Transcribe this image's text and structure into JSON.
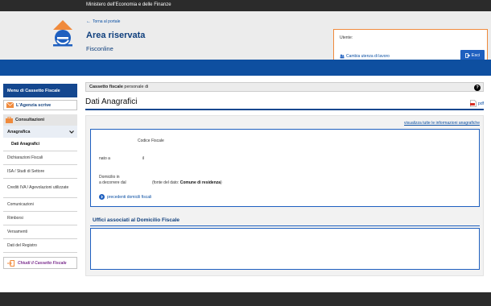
{
  "topbar": {
    "ministry": "Ministero dell'Economia e delle Finanze"
  },
  "header": {
    "back_link": "Torna al portale",
    "title": "Area riservata",
    "subtitle": "Fisconline"
  },
  "user": {
    "label": "Utente:",
    "change_link": "Cambia utenza di lavoro",
    "exit_label": "Esci"
  },
  "sidebar": {
    "menu_title": "Menu di Cassetto Fiscale",
    "agency": "L'Agenzia scrive",
    "consult": "Consultazioni",
    "anagrafica": "Anagrafica",
    "items": [
      "Dati Anagrafici",
      "Dichiarazioni Fiscali",
      "ISA / Studi di Settore",
      "Crediti IVA / Agevolazioni utilizzate",
      "Comunicazioni",
      "Rimborsi",
      "Versamenti",
      "Dati del Registro"
    ],
    "close": "Chiudi il Cassetto Fiscale"
  },
  "main": {
    "cassetto_bold": "Cassetto fiscale",
    "cassetto_rest": "personale di",
    "help": "?",
    "page_title": "Dati Anagrafici",
    "pdf": "pdf",
    "viz_link": "visualizza tutte le informazioni anagrafiche",
    "codice_fiscale": "Codice Fiscale",
    "nato_a": "nato a",
    "il": "il",
    "domicilio_1": "Domicilio in",
    "domicilio_2": "a decorrere dal",
    "fonte_pre": "(fonte del dato:",
    "fonte_bold": "Comune di residenza",
    "fonte_post": ")",
    "prev_link": "precedenti domicili fiscali",
    "uffici": "Uffici associati al Domicilio Fiscale"
  },
  "colors": {
    "brand_blue": "#0e4fa0",
    "accent_orange": "#f08a3c",
    "link_blue": "#0a4fa3"
  }
}
